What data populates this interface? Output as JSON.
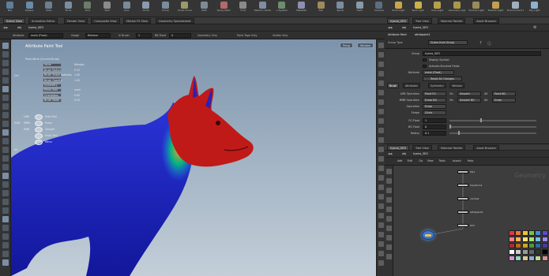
{
  "shelf": {
    "tools": [
      {
        "label": "Box",
        "color": "#5d7f9e"
      },
      {
        "label": "Sphere",
        "color": "#6a8aa8"
      },
      {
        "label": "Tube",
        "color": "#6b7f8f"
      },
      {
        "label": "Torus",
        "color": "#7a8da2"
      },
      {
        "label": "Grid",
        "color": "#6a7d6a"
      },
      {
        "label": "Null",
        "color": "#8b8b8b"
      },
      {
        "label": "Line",
        "color": "#7a8a9a"
      },
      {
        "label": "Circle",
        "color": "#8a9ab0"
      },
      {
        "label": "Curve",
        "color": "#7b8c9c"
      },
      {
        "label": "Draw Curve",
        "color": "#9a9a6b"
      },
      {
        "label": "Path",
        "color": "#7d8b99"
      },
      {
        "label": "Spray Paint",
        "color": "#b46a6a"
      },
      {
        "label": "Font",
        "color": "#8a8a8a"
      },
      {
        "label": "Platonic Solids",
        "color": "#7d8fa0"
      },
      {
        "label": "L-System",
        "color": "#6e8d6e"
      },
      {
        "label": "Metaball",
        "color": "#8f8fb0"
      },
      {
        "label": "File",
        "color": "#a08a5a"
      },
      {
        "label": "Spiral",
        "color": "#7b8ca2"
      },
      {
        "label": "Helix",
        "color": "#8899aa"
      },
      {
        "label": "Camera",
        "color": "#5c6e82"
      },
      {
        "label": "Point Light",
        "color": "#c9a64a"
      },
      {
        "label": "Spot Light",
        "color": "#c9b04a"
      },
      {
        "label": "Area Light",
        "color": "#b8a04a"
      },
      {
        "label": "Geometry Light",
        "color": "#a8984a"
      },
      {
        "label": "Volume Light",
        "color": "#9a8a5a"
      },
      {
        "label": "Distant Light",
        "color": "#c0a050"
      },
      {
        "label": "Environment Light",
        "color": "#a0b0c0"
      },
      {
        "label": "Sky Light",
        "color": "#8fb0d0"
      }
    ],
    "tabs": [
      "Create",
      "Modify",
      "Model",
      "Polygon",
      "Deform",
      "Texture",
      "Rigging",
      "Characters",
      "Constraints",
      "Hair Utils",
      "Guide Process",
      "Terrain FX",
      "Simple FX",
      "Volume",
      "Lights and Cameras",
      "Collisions",
      "Particles",
      "Grains",
      "Rigid Bodies",
      "Particle Fluids",
      "Viscous Fluids",
      "Oceans",
      "Fluid Containers",
      "Populate Containers",
      "Container Tools",
      "Pyro FX",
      "Sparse Pyro FX",
      "FEM",
      "Wires",
      "Crowds",
      "Drive Simulation"
    ]
  },
  "viewer": {
    "tabs": [
      "Scene View",
      "Animation Editor",
      "Render View",
      "Composite View",
      "Motion FX View",
      "Geometry Spreadsheet"
    ],
    "active_tab": 0,
    "path": [
      "obj",
      "hyena_GEO"
    ],
    "ops_bar": {
      "attribute_label": "Attribute",
      "attribute_value": "mask (Float)",
      "usage_label": "Usage",
      "usage_value": "Release",
      "in_brush_label": "In Brush",
      "in_brush_value": "1",
      "bbox_label": "BB Fixed",
      "bbox_value": "0",
      "geom_only": "Geometry Only",
      "paint_tape": "Paint Tape Only",
      "visible_only": "Visible Only"
    },
    "hud": {
      "title": "Attribute Paint Tool",
      "section": "Paint Attrib  (Current Brush)",
      "rows": [
        {
          "label": "Value",
          "value": "Window"
        },
        {
          "label": "Brush Radius",
          "value": "0.23"
        },
        {
          "label": "Brush Shape Softness",
          "value": "1.00"
        },
        {
          "label": "Brush Opacity",
          "value": "1.00"
        },
        {
          "label": "Symmetry",
          "value": ""
        },
        {
          "label": "Mirror Axis",
          "value": "none"
        },
        {
          "label": "Orientation",
          "value": "0.00"
        },
        {
          "label": "Brush Mode",
          "value": "0.00"
        }
      ],
      "actions": [
        {
          "key": "LMB",
          "label": "Paint Tool"
        },
        {
          "key": "MMB",
          "label": "Erase"
        },
        {
          "key": "RMB",
          "label": "Smooth"
        },
        {
          "key": "",
          "label": "Undo Tool"
        },
        {
          "key": "",
          "label": "Menu"
        }
      ],
      "hotkeys": [
        "Ctrl",
        "Shift",
        "Alt"
      ],
      "corner_buttons": [
        "Persp",
        "Window"
      ]
    }
  },
  "params": {
    "tabs": [
      "hyena_GEO",
      "Tree View",
      "Material Palette",
      "Asset Browser"
    ],
    "path": [
      "obj",
      "hyena_GEO"
    ],
    "node_type": "Attribute Paint",
    "node_name": "attribpaint1",
    "header": {
      "group_label": "Group",
      "group_value": "",
      "group_type_label": "Group Type",
      "group_type_value": "Guess from Group"
    },
    "rows": [
      {
        "label": "Group",
        "value": "hyena_GEO",
        "kind": "field"
      },
      {
        "label": "",
        "value": "Display Symbol",
        "kind": "check"
      },
      {
        "label": "",
        "value": "Activate Brushed Fields",
        "kind": "check"
      },
      {
        "label": "Attribute",
        "value": "mask (Float)",
        "kind": "menu"
      },
      {
        "label": "",
        "value": "Reset All Changes",
        "kind": "button"
      }
    ],
    "sub_tabs": [
      "Brush",
      "Attributes",
      "Symmetry",
      "Window"
    ],
    "active_sub_tab": 0,
    "fields": [
      {
        "label": "LMB Operation",
        "value": "Paint FG",
        "extra_label": "Vis",
        "extra_value": "Smooth",
        "extra2_label": "Alt",
        "extra2_value": "Paint BG"
      },
      {
        "label": "MMB Operation",
        "value": "Erase BG",
        "extra_label": "Vis",
        "extra_value": "Smooth BG",
        "extra2_label": "Alt",
        "extra2_value": "Erase"
      },
      {
        "label": "Operation",
        "value": "Erase",
        "extra_label": "",
        "extra_value": "",
        "extra2_label": "",
        "extra2_value": ""
      },
      {
        "label": "Shape",
        "value": "Circle",
        "extra_label": "",
        "extra_value": "",
        "extra2_label": "",
        "extra2_value": ""
      }
    ],
    "sliders": [
      {
        "label": "FG Float",
        "value": "1",
        "fraction": 0.35
      },
      {
        "label": "BG Float",
        "value": "0",
        "fraction": 0.0
      },
      {
        "label": "Radius",
        "value": "0.1",
        "fraction": 0.1
      }
    ]
  },
  "network": {
    "tabs": [
      "hyena_GEO",
      "Tree View",
      "Material Palette",
      "Asset Browser"
    ],
    "path": [
      "obj",
      "hyena_GEO"
    ],
    "menu": [
      "Add",
      "Edit",
      "Go",
      "View",
      "Tools",
      "Layout",
      "Help"
    ],
    "context_label": "Geometry",
    "nodes": [
      {
        "name": "file1"
      },
      {
        "name": "transform1"
      },
      {
        "name": "normal1"
      },
      {
        "name": "attribpaint1"
      },
      {
        "name": "OUT"
      }
    ],
    "palette": [
      "#e0393e",
      "#e8753a",
      "#f1c233",
      "#7bc043",
      "#3a8fd9",
      "#5b4bd1",
      "#ff7e86",
      "#ffb35c",
      "#ffe37a",
      "#a4e07a",
      "#7bbde8",
      "#9f86e8",
      "#b02a2a",
      "#b56a1e",
      "#c9a42a",
      "#4f9a32",
      "#2a6aa8",
      "#4b3a9e",
      "#ffffff",
      "#cccccc",
      "#999999",
      "#666666",
      "#333333",
      "#000000",
      "#d98fd0",
      "#8fd9c8",
      "#d9c88f",
      "#8fa8d9",
      "#c0d98f",
      "#d98f8f"
    ]
  },
  "mesh": {
    "body_color": "#1b21c8",
    "head_color": "#c01a18",
    "blend_colors": [
      "#ffb020",
      "#00d070",
      "#2080ff"
    ]
  }
}
